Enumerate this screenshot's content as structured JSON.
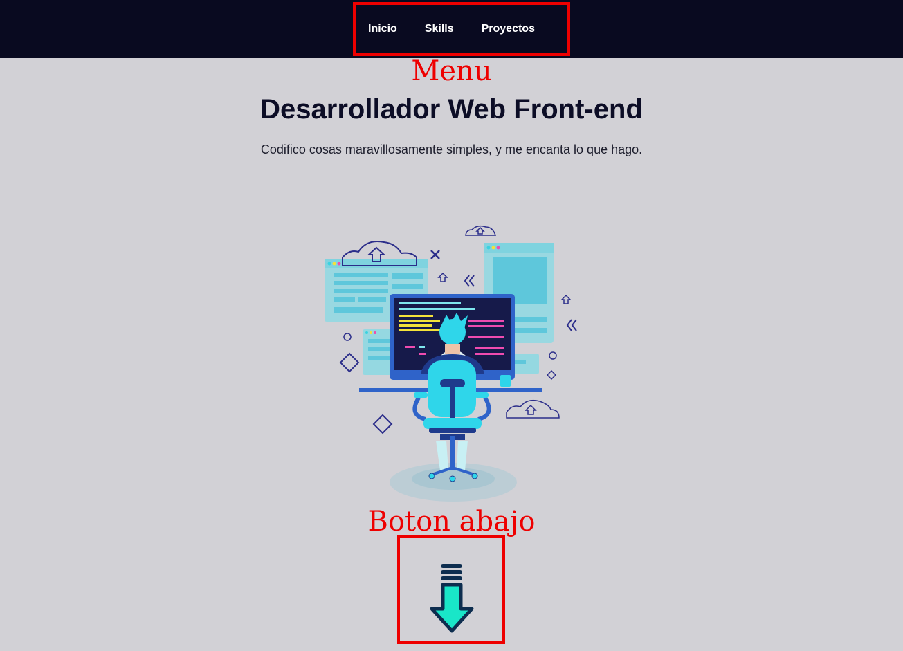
{
  "nav": {
    "links": [
      {
        "label": "Inicio"
      },
      {
        "label": "Skills"
      },
      {
        "label": "Proyectos"
      }
    ]
  },
  "annotations": {
    "menu_label": "Menu",
    "button_label": "Boton abajo",
    "color": "#ee0000"
  },
  "hero": {
    "title": "Desarrollador Web Front-end",
    "subtitle": "Codifico cosas maravillosamente simples, y me encanta lo que hago."
  },
  "illustration": {
    "icon": "developer-at-desk-illustration"
  },
  "down_button": {
    "icon": "arrow-down-icon",
    "fill": "#19e6c8",
    "stroke": "#0d2d4f"
  },
  "colors": {
    "navbar_bg": "#090a20",
    "page_bg": "#d2d1d6",
    "text_dark": "#0c0d26"
  }
}
